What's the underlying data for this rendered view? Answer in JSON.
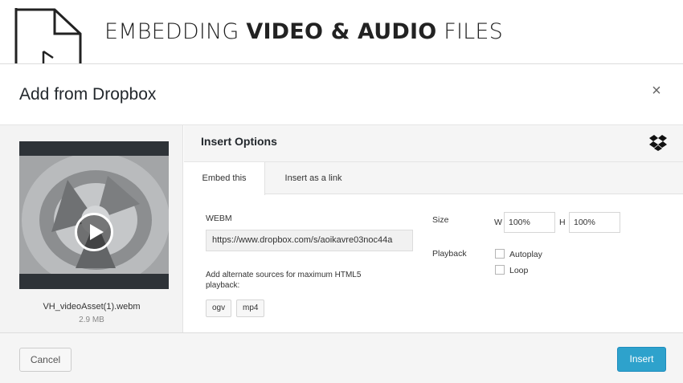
{
  "banner": {
    "title_prefix": "EMBEDDING ",
    "title_bold": "VIDEO & AUDIO",
    "title_suffix": " FILES",
    "icon": "video-file-icon"
  },
  "modal": {
    "title": "Add from Dropbox",
    "close_label": "×"
  },
  "file": {
    "name": "VH_videoAsset(1).webm",
    "size": "2.9 MB"
  },
  "options": {
    "title": "Insert Options",
    "brand_icon": "dropbox-icon",
    "tabs": [
      {
        "label": "Embed this",
        "active": true
      },
      {
        "label": "Insert as a link",
        "active": false
      }
    ],
    "format_label": "WEBM",
    "url": "https://www.dropbox.com/s/aoikavre03noc44a",
    "alt_sources_text": "Add alternate sources for maximum HTML5 playback:",
    "alt_sources": [
      "ogv",
      "mp4"
    ],
    "size_label": "Size",
    "width_label": "W",
    "width_value": "100%",
    "height_label": "H",
    "height_value": "100%",
    "playback_label": "Playback",
    "autoplay_label": "Autoplay",
    "autoplay_checked": false,
    "loop_label": "Loop",
    "loop_checked": false
  },
  "footer": {
    "cancel_label": "Cancel",
    "insert_label": "Insert"
  },
  "colors": {
    "primary_button": "#2ea2cc",
    "panel_bg": "#f5f5f5"
  }
}
